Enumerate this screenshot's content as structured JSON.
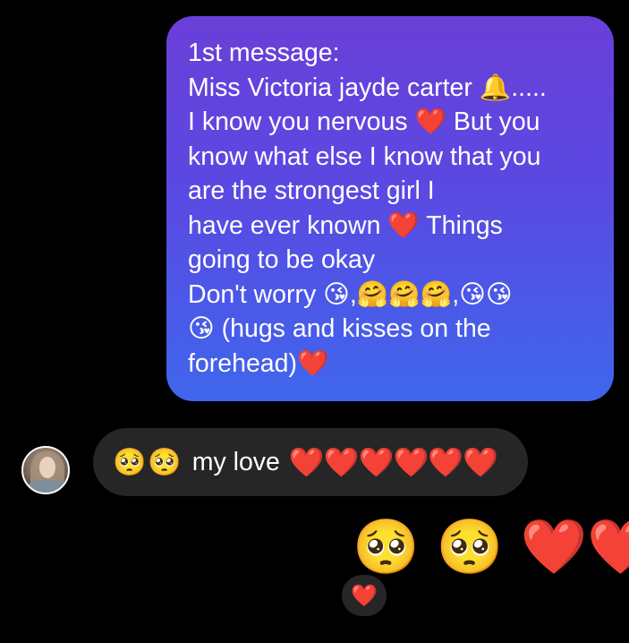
{
  "outgoing_message": {
    "lines": [
      "1st message:",
      "Miss Victoria jayde carter 🔔.....",
      "I know you nervous ❤️ But you",
      "know what else I know that you",
      "are the strongest girl I",
      "have ever known ❤️ Things",
      "going to be okay",
      "Don't worry 😘,🤗🤗🤗,😘😘",
      "😘 (hugs and kisses on the",
      "forehead)❤️"
    ]
  },
  "incoming_message": {
    "avatar_icon": "user-avatar-photo",
    "prefix_emoji": "🥺🥺",
    "text": "my love",
    "hearts": "❤️❤️❤️❤️❤️❤️"
  },
  "outgoing_emoji_message": {
    "pleading": "🥺 🥺",
    "hearts": "❤️❤️"
  },
  "reaction": {
    "emoji": "❤️"
  },
  "colors": {
    "background": "#000000",
    "outgoing_gradient_top": "#6a3fd8",
    "outgoing_gradient_bottom": "#3f66ec",
    "incoming_bubble": "#262626",
    "heart": "#e5283d"
  }
}
